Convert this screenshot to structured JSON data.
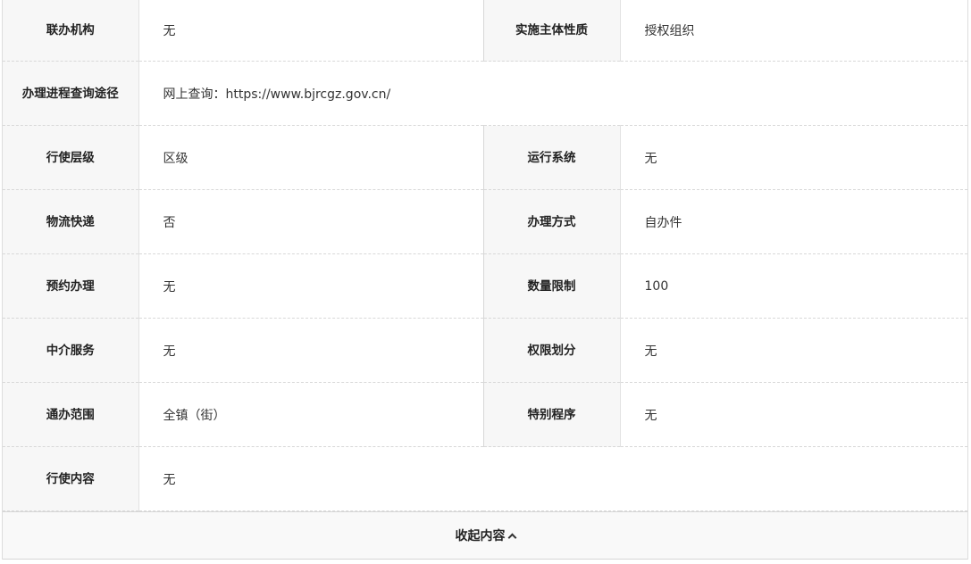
{
  "rows": [
    {
      "label_left": "联办机构",
      "value_left": "无",
      "label_right": "实施主体性质",
      "value_right": "授权组织"
    },
    {
      "label": "办理进程查询途径",
      "value": "网上查询：https://www.bjrcgz.gov.cn/"
    },
    {
      "label_left": "行使层级",
      "value_left": "区级",
      "label_right": "运行系统",
      "value_right": "无"
    },
    {
      "label_left": "物流快递",
      "value_left": "否",
      "label_right": "办理方式",
      "value_right": "自办件"
    },
    {
      "label_left": "预约办理",
      "value_left": "无",
      "label_right": "数量限制",
      "value_right": "100"
    },
    {
      "label_left": "中介服务",
      "value_left": "无",
      "label_right": "权限划分",
      "value_right": "无"
    },
    {
      "label_left": "通办范围",
      "value_left": "全镇（街）",
      "label_right": "特别程序",
      "value_right": "无"
    },
    {
      "label": "行使内容",
      "value": "无"
    }
  ],
  "collapse_button": {
    "label": "收起内容",
    "icon": "chevron-up-icon"
  }
}
